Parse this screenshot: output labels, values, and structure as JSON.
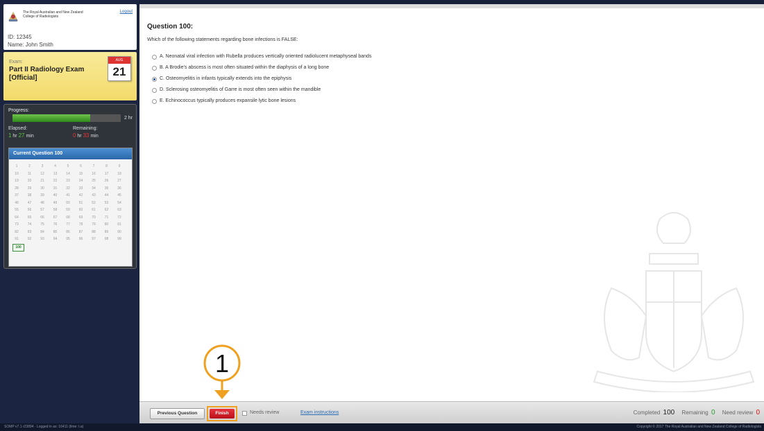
{
  "header": {
    "college_name": "The Royal Australian and New Zealand College of Radiologists",
    "logout_label": "Logout",
    "user_id": "ID: 12345",
    "user_name": "Name: John Smith"
  },
  "exam": {
    "label": "Exam:",
    "title": "Part II Radiology Exam [Official]",
    "calendar_month": "AUG",
    "calendar_day": "21"
  },
  "progress": {
    "label": "Progress:",
    "fraction": 0.72,
    "total": "2 hr",
    "elapsed_title": "Elapsed:",
    "elapsed_hr": "1",
    "elapsed_min": "27",
    "remaining_title": "Remaining:",
    "remaining_hr": "0",
    "remaining_min": "33",
    "hr_unit": "hr",
    "min_unit": "min"
  },
  "question_grid": {
    "header": "Current Question 100",
    "current": 100,
    "total": 100
  },
  "question": {
    "title": "Question 100:",
    "text": "Which of the following statements regarding bone infections is FALSE:",
    "selected_index": 2,
    "options": [
      "A. Neonatal viral infection with Rubella produces vertically oriented radiolucent metaphyseal bands",
      "B. A Brodie's abscess is most often situated within the diaphysis of a long bone",
      "C. Osteomyelitis in infants typically extends into the epiphysis",
      "D. Sclerosing osteomyelitis of Garre is most often seen within the mandible",
      "E. Echinococcus typically produces expansile lytic bone lesions"
    ]
  },
  "footer": {
    "prev_label": "Previous Question",
    "finish_label": "Finish",
    "review_label": "Needs review",
    "instructions_label": "Exam instructions",
    "completed_label": "Completed",
    "completed_value": "100",
    "remaining_label": "Remaining",
    "remaining_value": "0",
    "review_status_label": "Need review",
    "review_value": "0"
  },
  "callout": {
    "number": "1",
    "color": "#f0a020"
  },
  "bottom_bar": {
    "left_text": "SOMP v7.1 r23894 · Logged in as: 16411 (time: t.a)",
    "right_text": "Copyright © 2017 The Royal Australian and New Zealand College of Radiologists"
  }
}
